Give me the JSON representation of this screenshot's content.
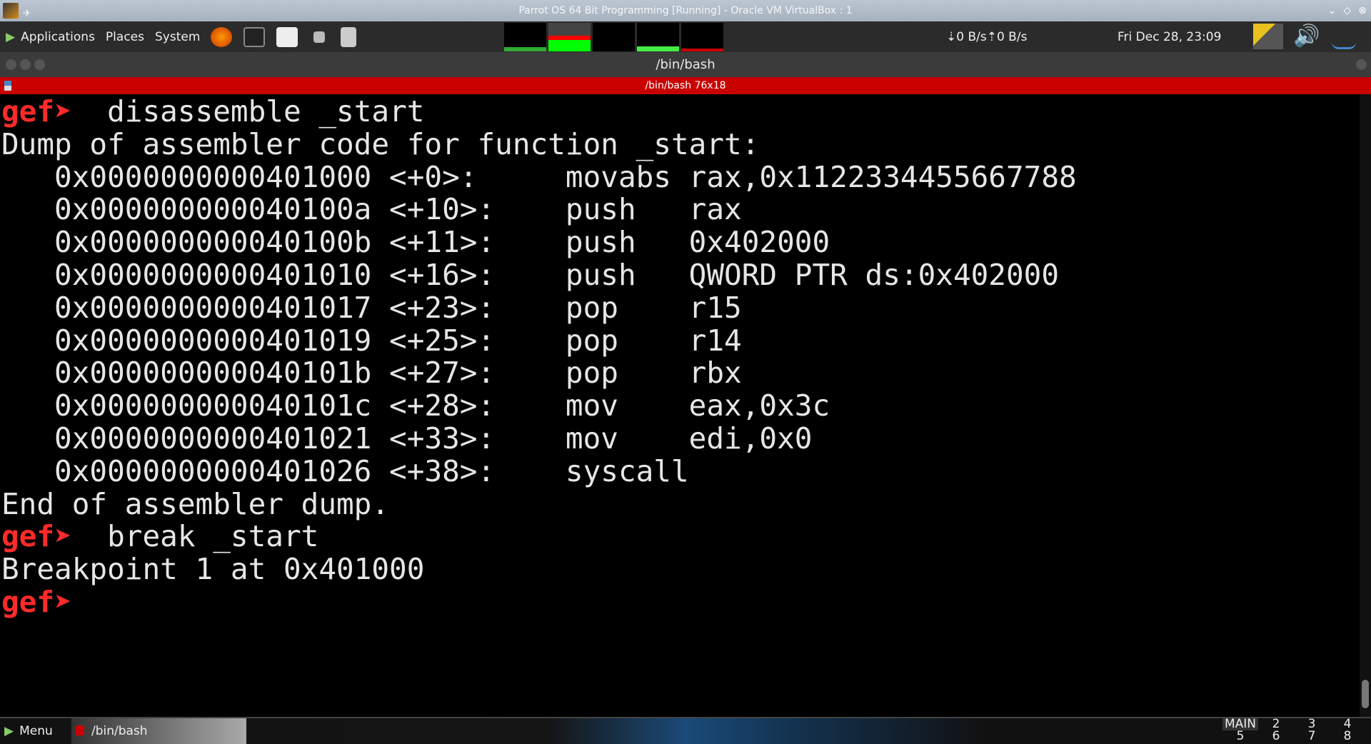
{
  "vbox": {
    "title": "Parrot OS 64 Bit Programming [Running] - Oracle VM VirtualBox : 1"
  },
  "panel": {
    "menus": [
      "Applications",
      "Places",
      "System"
    ],
    "net": "⇣0 B/s⇡0 B/s",
    "clock": "Fri Dec 28, 23:09"
  },
  "window": {
    "title": "/bin/bash",
    "tab": "/bin/bash 76x18"
  },
  "terminal": {
    "prompt": "gef➤",
    "lines": [
      {
        "p": true,
        "t": "  disassemble _start"
      },
      {
        "t": "Dump of assembler code for function _start:"
      },
      {
        "t": "   0x0000000000401000 <+0>:     movabs rax,0x1122334455667788"
      },
      {
        "t": "   0x000000000040100a <+10>:    push   rax"
      },
      {
        "t": "   0x000000000040100b <+11>:    push   0x402000"
      },
      {
        "t": "   0x0000000000401010 <+16>:    push   QWORD PTR ds:0x402000"
      },
      {
        "t": "   0x0000000000401017 <+23>:    pop    r15"
      },
      {
        "t": "   0x0000000000401019 <+25>:    pop    r14"
      },
      {
        "t": "   0x000000000040101b <+27>:    pop    rbx"
      },
      {
        "t": "   0x000000000040101c <+28>:    mov    eax,0x3c"
      },
      {
        "t": "   0x0000000000401021 <+33>:    mov    edi,0x0"
      },
      {
        "t": "   0x0000000000401026 <+38>:    syscall"
      },
      {
        "t": "End of assembler dump."
      },
      {
        "p": true,
        "t": "  break _start"
      },
      {
        "t": "Breakpoint 1 at 0x401000"
      },
      {
        "p": true,
        "t": ""
      }
    ]
  },
  "taskbar": {
    "menu": "Menu",
    "task": "/bin/bash",
    "workspaces": [
      "MAIN",
      "2",
      "3",
      "4",
      "5",
      "6",
      "7",
      "8"
    ]
  }
}
